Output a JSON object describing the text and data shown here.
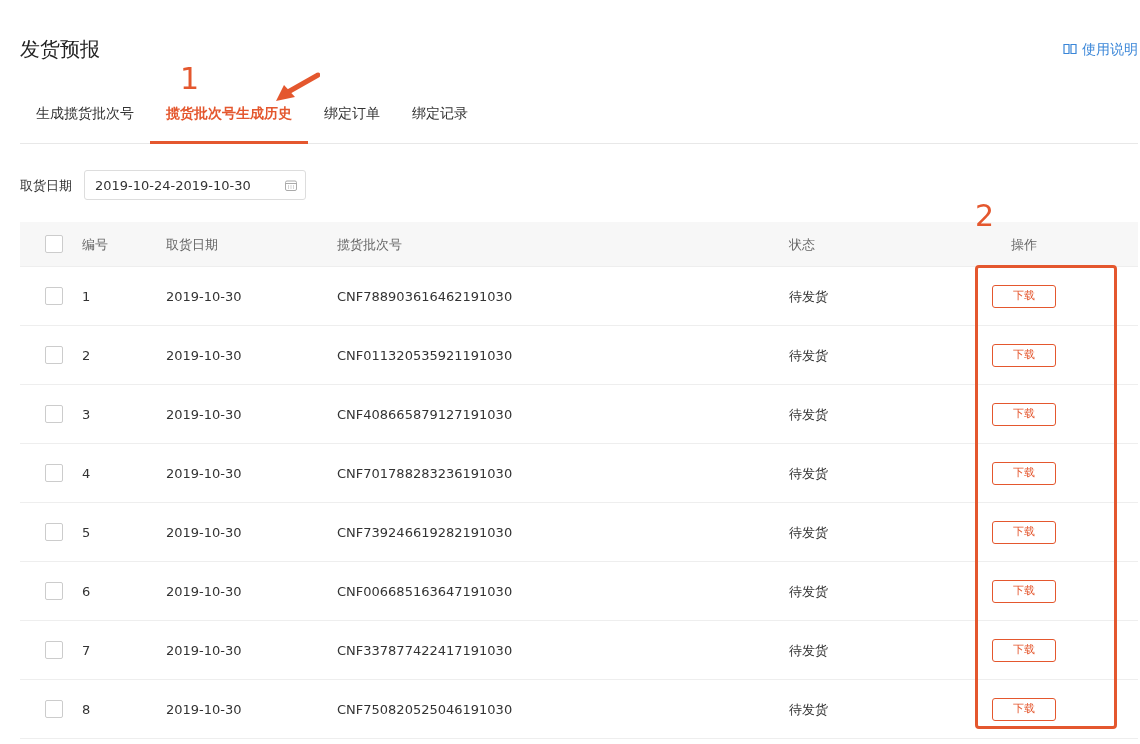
{
  "page": {
    "title": "发货预报",
    "help_link": "使用说明"
  },
  "tabs": [
    {
      "label": "生成揽货批次号",
      "selected": false
    },
    {
      "label": "揽货批次号生成历史",
      "selected": true
    },
    {
      "label": "绑定订单",
      "selected": false
    },
    {
      "label": "绑定记录",
      "selected": false
    }
  ],
  "filter": {
    "label": "取货日期",
    "value": "2019-10-24-2019-10-30"
  },
  "table": {
    "columns": [
      "编号",
      "取货日期",
      "揽货批次号",
      "状态",
      "操作"
    ],
    "select_all": {
      "checked": false
    },
    "rows": [
      {
        "checked": false,
        "cells": [
          "1",
          "2019-10-30",
          "CNF788903616462191030",
          "待发货"
        ],
        "action": "下载"
      },
      {
        "checked": false,
        "cells": [
          "2",
          "2019-10-30",
          "CNF011320535921191030",
          "待发货"
        ],
        "action": "下载"
      },
      {
        "checked": false,
        "cells": [
          "3",
          "2019-10-30",
          "CNF408665879127191030",
          "待发货"
        ],
        "action": "下载"
      },
      {
        "checked": false,
        "cells": [
          "4",
          "2019-10-30",
          "CNF701788283236191030",
          "待发货"
        ],
        "action": "下载"
      },
      {
        "checked": false,
        "cells": [
          "5",
          "2019-10-30",
          "CNF739246619282191030",
          "待发货"
        ],
        "action": "下载"
      },
      {
        "checked": false,
        "cells": [
          "6",
          "2019-10-30",
          "CNF006685163647191030",
          "待发货"
        ],
        "action": "下载"
      },
      {
        "checked": false,
        "cells": [
          "7",
          "2019-10-30",
          "CNF337877422417191030",
          "待发货"
        ],
        "action": "下载"
      },
      {
        "checked": false,
        "cells": [
          "8",
          "2019-10-30",
          "CNF750820525046191030",
          "待发货"
        ],
        "action": "下载"
      }
    ]
  },
  "annotations": [
    {
      "label": "1"
    },
    {
      "label": "2"
    }
  ]
}
